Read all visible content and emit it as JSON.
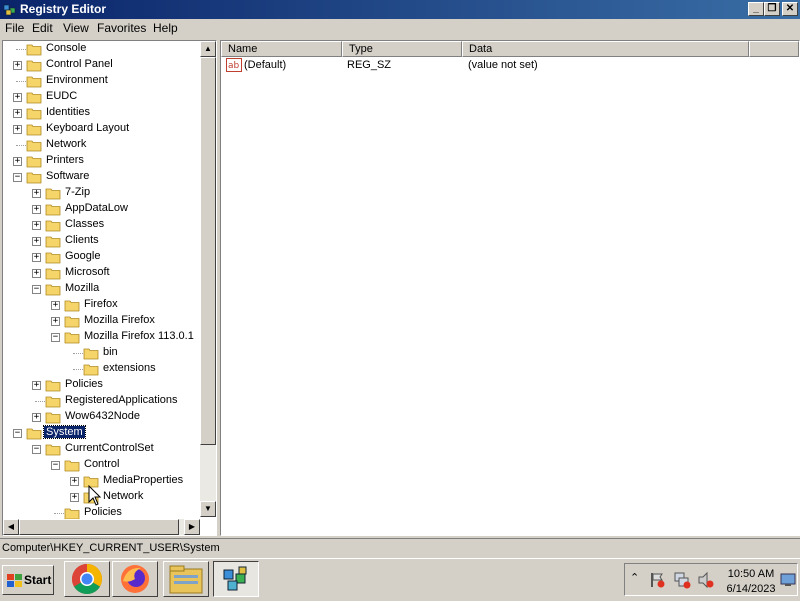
{
  "window": {
    "title": "Registry Editor",
    "minimize": "_",
    "restore": "❐",
    "close": "✕"
  },
  "menu": [
    "File",
    "Edit",
    "View",
    "Favorites",
    "Help"
  ],
  "tree": [
    {
      "label": "Console",
      "expander": "",
      "level": 1
    },
    {
      "label": "Control Panel",
      "expander": "+",
      "level": 1
    },
    {
      "label": "Environment",
      "expander": "",
      "level": 1
    },
    {
      "label": "EUDC",
      "expander": "+",
      "level": 1
    },
    {
      "label": "Identities",
      "expander": "+",
      "level": 1
    },
    {
      "label": "Keyboard Layout",
      "expander": "+",
      "level": 1
    },
    {
      "label": "Network",
      "expander": "",
      "level": 1
    },
    {
      "label": "Printers",
      "expander": "+",
      "level": 1
    },
    {
      "label": "Software",
      "expander": "-",
      "level": 1
    },
    {
      "label": "7-Zip",
      "expander": "+",
      "level": 2
    },
    {
      "label": "AppDataLow",
      "expander": "+",
      "level": 2
    },
    {
      "label": "Classes",
      "expander": "+",
      "level": 2
    },
    {
      "label": "Clients",
      "expander": "+",
      "level": 2
    },
    {
      "label": "Google",
      "expander": "+",
      "level": 2
    },
    {
      "label": "Microsoft",
      "expander": "+",
      "level": 2
    },
    {
      "label": "Mozilla",
      "expander": "-",
      "level": 2
    },
    {
      "label": "Firefox",
      "expander": "+",
      "level": 3
    },
    {
      "label": "Mozilla Firefox",
      "expander": "+",
      "level": 3
    },
    {
      "label": "Mozilla Firefox 113.0.1",
      "expander": "-",
      "level": 3
    },
    {
      "label": "bin",
      "expander": "",
      "level": 4
    },
    {
      "label": "extensions",
      "expander": "",
      "level": 4
    },
    {
      "label": "Policies",
      "expander": "+",
      "level": 2
    },
    {
      "label": "RegisteredApplications",
      "expander": "",
      "level": 2
    },
    {
      "label": "Wow6432Node",
      "expander": "+",
      "level": 2
    },
    {
      "label": "System",
      "expander": "-",
      "level": 1,
      "selected": true
    },
    {
      "label": "CurrentControlSet",
      "expander": "-",
      "level": 2
    },
    {
      "label": "Control",
      "expander": "-",
      "level": 3
    },
    {
      "label": "MediaProperties",
      "expander": "+",
      "level": 4
    },
    {
      "label": "Network",
      "expander": "+",
      "level": 4
    },
    {
      "label": "Policies",
      "expander": "",
      "level": 3
    }
  ],
  "list": {
    "columns": [
      "Name",
      "Type",
      "Data"
    ],
    "rows": [
      {
        "name": "(Default)",
        "type": "REG_SZ",
        "data": "(value not set)"
      }
    ]
  },
  "status": "Computer\\HKEY_CURRENT_USER\\System",
  "taskbar": {
    "start": "Start",
    "apps": [
      "chrome-icon",
      "firefox-icon",
      "explorer-icon",
      "regedit-icon"
    ],
    "time": "10:50 AM",
    "date": "6/14/2023"
  },
  "colors": {
    "titlebar": "#0a246a",
    "selection": "#0a246a",
    "folder": "#f5d46a"
  }
}
